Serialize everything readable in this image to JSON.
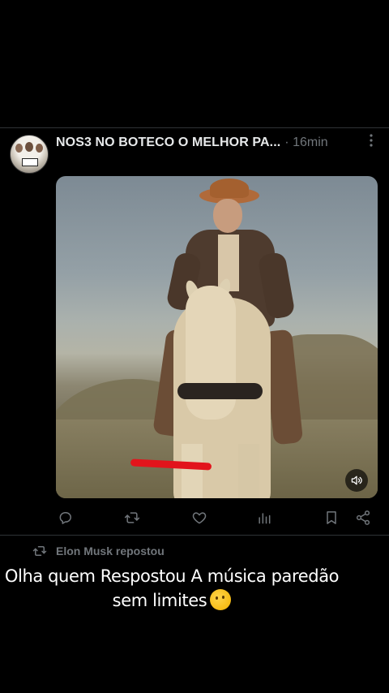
{
  "post": {
    "author_name": "NOS3 NO BOTECO O MELHOR PA...",
    "timestamp": "· 16min",
    "more_icon": "more-vertical-icon",
    "media_type": "video",
    "media_muted": true
  },
  "actions": [
    {
      "icon": "reply-icon"
    },
    {
      "icon": "repost-icon"
    },
    {
      "icon": "like-icon"
    },
    {
      "icon": "views-icon"
    },
    {
      "icon": "bookmark-icon"
    },
    {
      "icon": "share-icon"
    }
  ],
  "repost": {
    "text": "Elon Musk repostou"
  },
  "caption": {
    "line1": "Olha quem Respostou A música paredão",
    "line2": "sem limites"
  },
  "colors": {
    "background": "#000000",
    "text_primary": "#e7e9ea",
    "text_secondary": "#71767b",
    "divider": "#2f3336",
    "highlight_mark": "#e2141c"
  }
}
